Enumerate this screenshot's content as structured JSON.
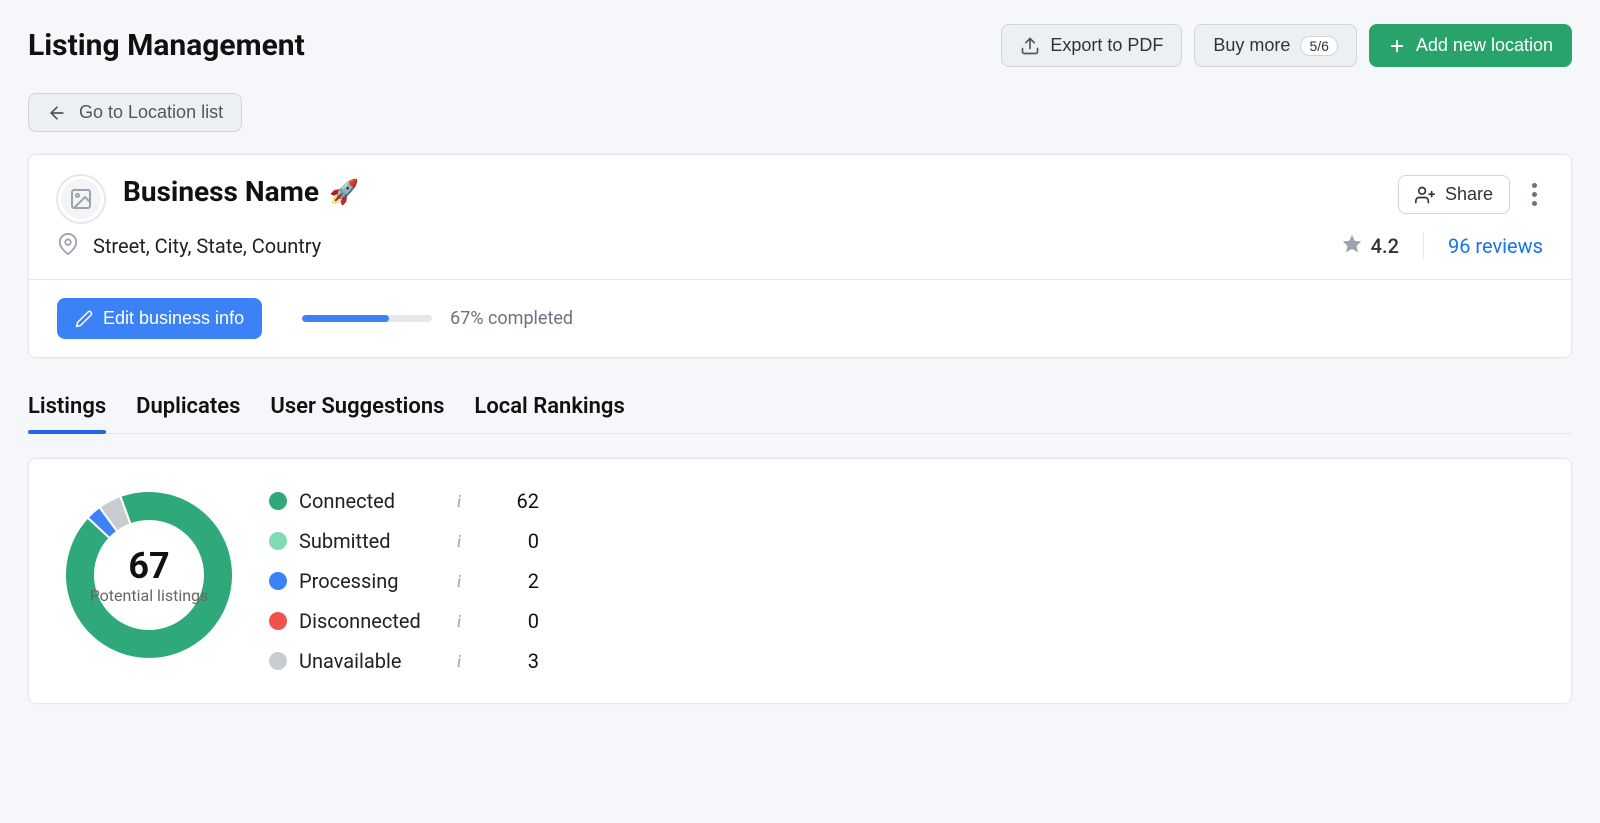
{
  "header": {
    "title": "Listing Management",
    "export_label": "Export to PDF",
    "buy_more_label": "Buy more",
    "buy_more_count": "5/6",
    "add_location_label": "Add new location",
    "back_label": "Go to Location list"
  },
  "business": {
    "name": "Business Name",
    "emoji": "🚀",
    "address": "Street, City, State, Country",
    "rating": "4.2",
    "reviews_text": "96 reviews",
    "share_label": "Share",
    "edit_label": "Edit business info",
    "progress_pct": 67,
    "progress_label": "67% completed"
  },
  "tabs": {
    "items": [
      {
        "label": "Listings",
        "active": true
      },
      {
        "label": "Duplicates",
        "active": false
      },
      {
        "label": "User Suggestions",
        "active": false
      },
      {
        "label": "Local Rankings",
        "active": false
      }
    ]
  },
  "donut": {
    "total": "67",
    "label": "Potential listings"
  },
  "legend": {
    "items": [
      {
        "label": "Connected",
        "value": "62",
        "color": "#2fa97a"
      },
      {
        "label": "Submitted",
        "value": "0",
        "color": "#7fdcb0"
      },
      {
        "label": "Processing",
        "value": "2",
        "color": "#3b82f6"
      },
      {
        "label": "Disconnected",
        "value": "0",
        "color": "#ef5350"
      },
      {
        "label": "Unavailable",
        "value": "3",
        "color": "#c8ccd0"
      }
    ]
  },
  "chart_data": {
    "type": "pie",
    "title": "Potential listings",
    "total": 67,
    "series": [
      {
        "name": "Connected",
        "value": 62,
        "color": "#2fa97a"
      },
      {
        "name": "Submitted",
        "value": 0,
        "color": "#7fdcb0"
      },
      {
        "name": "Processing",
        "value": 2,
        "color": "#3b82f6"
      },
      {
        "name": "Disconnected",
        "value": 0,
        "color": "#ef5350"
      },
      {
        "name": "Unavailable",
        "value": 3,
        "color": "#c8ccd0"
      }
    ]
  }
}
